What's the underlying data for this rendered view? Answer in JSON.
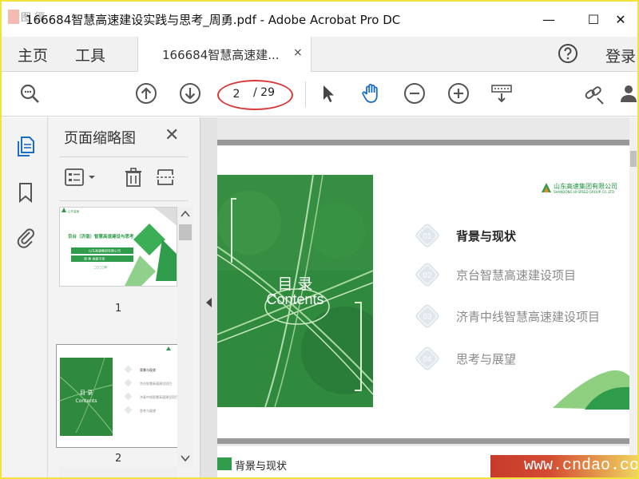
{
  "window": {
    "title": "166684智慧高速建设实践与思考_周勇.pdf - Adobe Acrobat Pro DC",
    "minimize_glyph": "—",
    "maximize_glyph": "☐",
    "close_glyph": "✕"
  },
  "menu": {
    "home": "主页",
    "tools": "工具",
    "tab_label": "166684智慧高速建...",
    "tab_close": "×",
    "login": "登录"
  },
  "toolbar": {
    "current_page": "2",
    "total_pages": "/ 29",
    "icons": [
      "zoom-search-icon",
      "page-up-icon",
      "page-down-icon",
      "select-arrow-icon",
      "hand-icon",
      "zoom-out-icon",
      "zoom-in-icon",
      "scroll-mode-icon",
      "link-icon",
      "user-icon"
    ]
  },
  "thumbnails": {
    "title": "页面缩略图",
    "close": "✕",
    "pages": [
      {
        "number": "1",
        "heading": "京台（济南）智慧高速建设与思考",
        "banner": "山东高速集团有限公司",
        "sub": "周  勇    高级专家",
        "date": "二〇二〇年"
      },
      {
        "number": "2",
        "title": "目 录",
        "subtitle": "Contents"
      }
    ]
  },
  "document": {
    "company_cn": "山东高速集团有限公司",
    "company_en": "SHANDONG HI-SPEED GROUP CO.,LTD",
    "toc_title": "目 录",
    "toc_subtitle": "Contents",
    "toc": [
      {
        "num": "01",
        "label": "背景与现状",
        "active": true
      },
      {
        "num": "02",
        "label": "京台智慧高速建设项目",
        "active": false
      },
      {
        "num": "03",
        "label": "济青中线智慧高速建设项目",
        "active": false
      },
      {
        "num": "04",
        "label": "思考与展望",
        "active": false
      }
    ],
    "next_page_heading": "背景与现状"
  },
  "watermark": {
    "text": "www.cndao.com"
  },
  "colors": {
    "accent_blue": "#1a6ec8",
    "brand_green": "#2e9c4a",
    "toc_active": "#222222",
    "toc_inactive": "#8a8a8a",
    "highlight_red": "#d83a3a",
    "frame_yellow": "#f2e33a"
  }
}
